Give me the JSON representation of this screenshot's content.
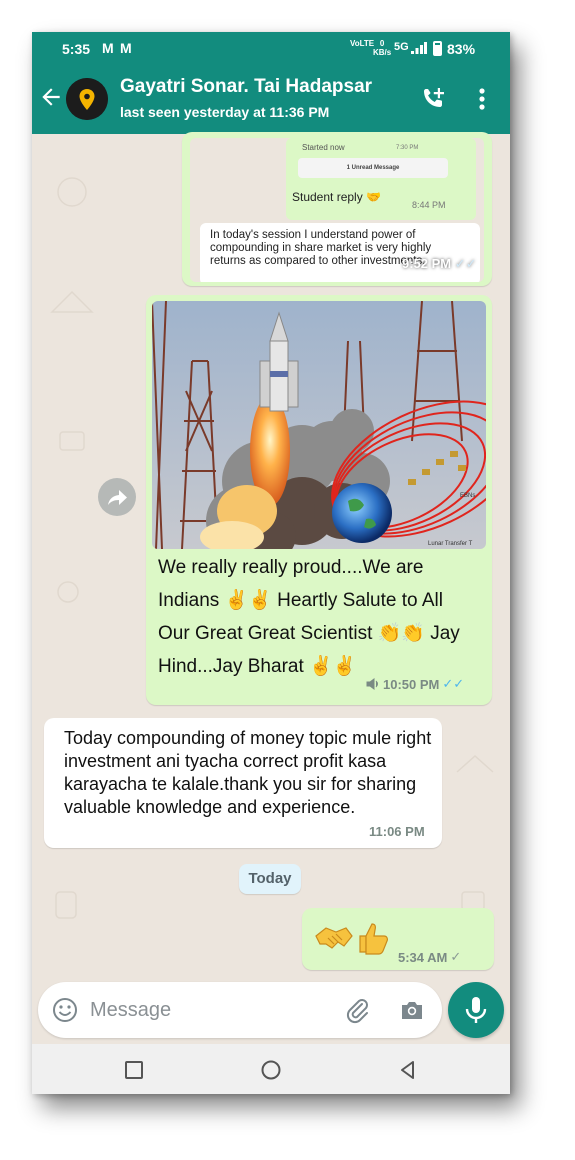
{
  "status_bar": {
    "time": "5:35",
    "mail_icon": "gmail-icon",
    "volte": "VoLTE",
    "network_speed": "0",
    "speed_unit": "KB/s",
    "network": "5G",
    "battery": "83%"
  },
  "header": {
    "contact_name": "Gayatri Sonar. Tai Hadapsar",
    "last_seen": "last seen yesterday at 11:36 PM",
    "icons": [
      "back-arrow-icon",
      "avatar",
      "add-call-icon",
      "more-vert-icon"
    ]
  },
  "messages": {
    "quoted": {
      "started": "Started now",
      "started_time": "7:30 PM",
      "unread_label": "1 Unread Message",
      "student_reply": "Student reply 🤝",
      "student_reply_time": "8:44 PM",
      "text": "In today's session I understand power of compounding in share market is very highly returns as compared to other investments.",
      "time": "9:52 PM"
    },
    "image_message": {
      "caption_line1": "We really really proud....We are",
      "caption_line2": "Indians ✌️✌️ Heartly Salute to All",
      "caption_line3": "Our Great Great Scientist 👏👏 Jay",
      "caption_line4": "Hind...Jay Bharat ✌️✌️",
      "time": "10:50 PM",
      "image_labels": {
        "orbit_label": "EBNs",
        "transfer_label": "Lunar Transfer T"
      }
    },
    "incoming": {
      "text": "Today compounding of money topic mule right investment ani tyacha correct profit kasa karayacha te kalale.thank you sir for sharing valuable knowledge and experience.",
      "time": "11:06 PM"
    },
    "date_chip": "Today",
    "emoji_reply": {
      "time": "5:34 AM"
    }
  },
  "input": {
    "placeholder": "Message"
  },
  "colors": {
    "header": "#128c7e",
    "outgoing_bubble": "#dcf8c6",
    "incoming_bubble": "#ffffff",
    "background": "#ece5dd",
    "blue_tick": "#4fb6ec"
  }
}
